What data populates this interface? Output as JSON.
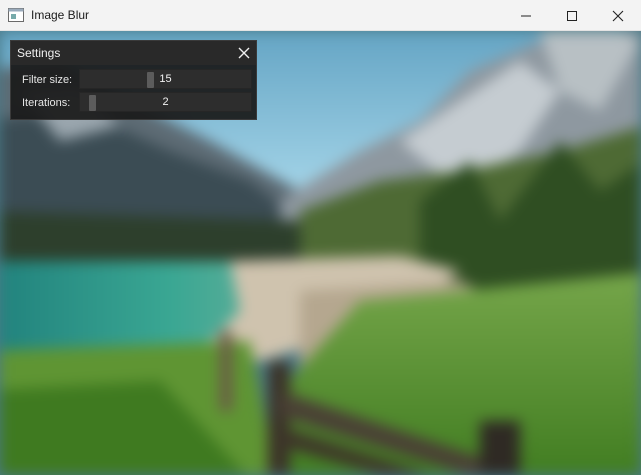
{
  "window": {
    "title": "Image Blur",
    "icons": {
      "app": "app-window-icon",
      "minimize": "minimize-icon",
      "maximize": "maximize-icon",
      "close": "close-icon"
    }
  },
  "scene": {
    "description_icon": "blurred-landscape-image",
    "colors": {
      "sky": "#9fd2ea",
      "water": "#2e9a90",
      "grass": "#4f8e2a",
      "mountain": "#7d8a95"
    }
  },
  "settings": {
    "title": "Settings",
    "close_icon": "close-icon",
    "rows": [
      {
        "label": "Filter size:",
        "value": "15",
        "fraction": 0.41
      },
      {
        "label": "Iterations:",
        "value": "2",
        "fraction": 0.07
      }
    ]
  }
}
